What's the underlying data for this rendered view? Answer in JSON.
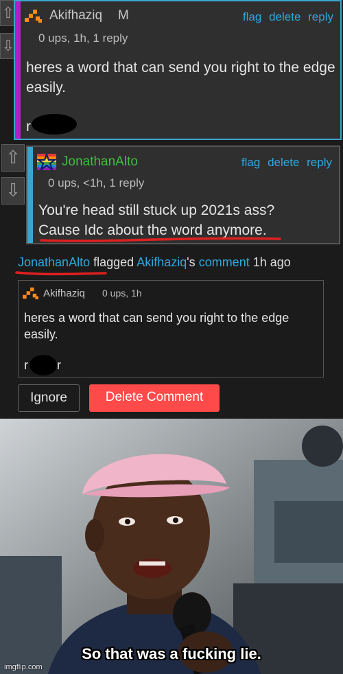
{
  "comment1": {
    "username": "Akifhaziq",
    "badge": "M",
    "meta": "0 ups, 1h, 1 reply",
    "actions": [
      "flag",
      "delete",
      "reply"
    ],
    "body": "heres a word that can send you right to the edge easily.",
    "redacted_word_start": "r"
  },
  "comment2": {
    "username": "JonathanAlto",
    "meta": "0 ups, <1h, 1 reply",
    "actions": [
      "flag",
      "delete",
      "reply"
    ],
    "body_line1": "You're head still stuck up 2021s ass?",
    "body_line2": "Cause Idc about the word anymore."
  },
  "flag_notice": {
    "flagger": "JonathanAlto",
    "flagged_text": "flagged",
    "target_user": "Akifhaziq",
    "possessive": "'s",
    "comment_link": "comment",
    "time": "1h ago",
    "quoted": {
      "username": "Akifhaziq",
      "meta": "0 ups, 1h",
      "body": "heres a word that can send you right to the edge easily.",
      "redacted_start": "r",
      "redacted_end": "r"
    },
    "ignore_label": "Ignore",
    "delete_label": "Delete Comment"
  },
  "meme": {
    "caption": "So that was a fucking lie.",
    "watermark": "imgflip.com"
  },
  "colors": {
    "link": "#2ea8dc",
    "panel_border": "#3aa6cf",
    "accent_purple": "#b21fc7",
    "accent_blue": "#3aa6cf",
    "delete_red": "#ff4a4a",
    "username_green": "#3fbf3f",
    "underline_red": "#e02020"
  }
}
